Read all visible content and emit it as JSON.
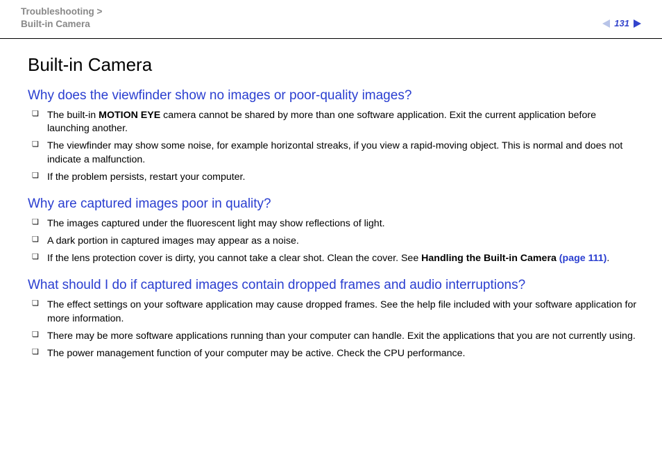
{
  "header": {
    "breadcrumb_section": "Troubleshooting",
    "breadcrumb_sep": " > ",
    "breadcrumb_page": "Built-in Camera",
    "page_number": "131"
  },
  "main": {
    "title": "Built-in Camera",
    "sections": [
      {
        "heading": "Why does the viewfinder show no images or poor-quality images?",
        "items": [
          {
            "pre": "The built‑in ",
            "bold": "MOTION EYE",
            "post": " camera cannot be shared by more than one software application. Exit the current application before launching another."
          },
          {
            "text": "The viewfinder may show some noise, for example horizontal streaks, if you view a rapid-moving object. This is normal and does not indicate a malfunction."
          },
          {
            "text": "If the problem persists, restart your computer."
          }
        ]
      },
      {
        "heading": "Why are captured images poor in quality?",
        "items": [
          {
            "text": "The images captured under the fluorescent light may show reflections of light."
          },
          {
            "text": "A dark portion in captured images may appear as a noise."
          },
          {
            "pre": "If the lens protection cover is dirty, you cannot take a clear shot. Clean the cover. See ",
            "bold": "Handling the Built-in Camera ",
            "link": "(page 111)",
            "post": "."
          }
        ]
      },
      {
        "heading": "What should I do if captured images contain dropped frames and audio interruptions?",
        "items": [
          {
            "text": "The effect settings on your software application may cause dropped frames. See the help file included with your software application for more information."
          },
          {
            "text": "There may be more software applications running than your computer can handle. Exit the applications that you are not currently using."
          },
          {
            "text": "The power management function of your computer may be active. Check the CPU performance."
          }
        ]
      }
    ]
  }
}
